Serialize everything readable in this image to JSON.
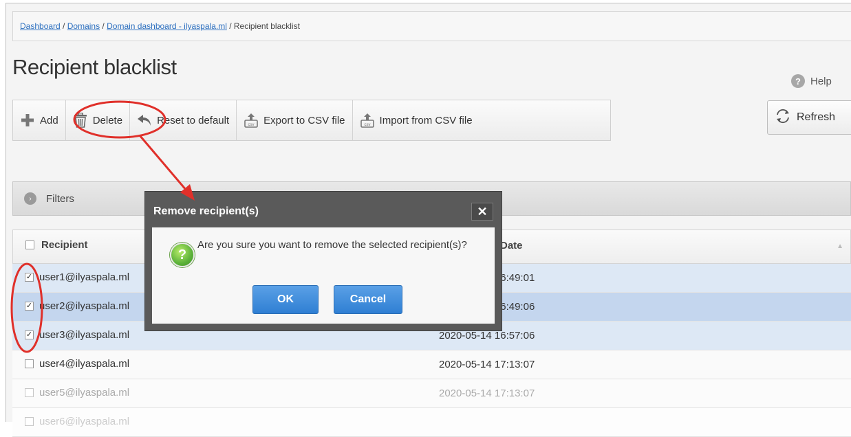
{
  "breadcrumb": {
    "items": [
      "Dashboard",
      "Domains",
      "Domain dashboard - ilyaspala.ml"
    ],
    "current": "Recipient blacklist",
    "separator": " / "
  },
  "page": {
    "title": "Recipient blacklist",
    "help_label": "Help"
  },
  "toolbar": {
    "add_label": "Add",
    "delete_label": "Delete",
    "reset_label": "Reset to default",
    "export_label": "Export to CSV file",
    "import_label": "Import from CSV file",
    "refresh_label": "Refresh"
  },
  "filters": {
    "label": "Filters"
  },
  "table": {
    "columns": [
      "Recipient",
      "Date"
    ],
    "rows": [
      {
        "recipient": "user1@ilyaspala.ml",
        "date": "2020-05-14 16:49:01",
        "checked": true
      },
      {
        "recipient": "user2@ilyaspala.ml",
        "date": "2020-05-14 16:49:06",
        "checked": true
      },
      {
        "recipient": "user3@ilyaspala.ml",
        "date": "2020-05-14 16:57:06",
        "checked": true
      },
      {
        "recipient": "user4@ilyaspala.ml",
        "date": "2020-05-14 17:13:07",
        "checked": false
      },
      {
        "recipient": "user5@ilyaspala.ml",
        "date": "2020-05-14 17:13:07",
        "checked": false
      },
      {
        "recipient": "user6@ilyaspala.ml",
        "date": "",
        "checked": false
      }
    ]
  },
  "dialog": {
    "title": "Remove recipient(s)",
    "message": "Are you sure you want to remove the selected recipient(s)?",
    "ok_label": "OK",
    "cancel_label": "Cancel",
    "close_glyph": "✕"
  },
  "colors": {
    "annotation": "#e0302a",
    "accent": "#2f7fd3",
    "link": "#2c6fbf"
  }
}
